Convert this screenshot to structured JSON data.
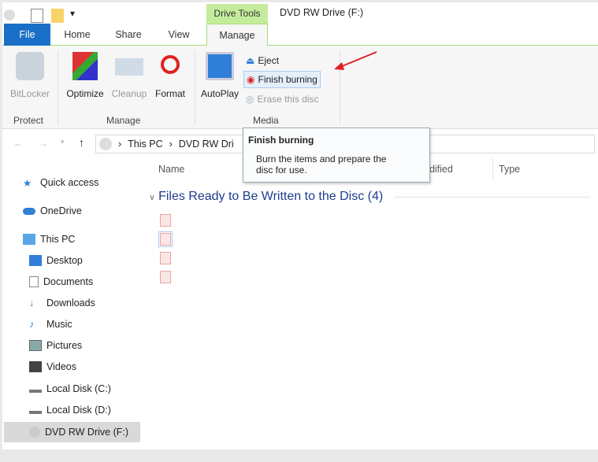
{
  "titlebar": {
    "context_tab": "Drive Tools",
    "title": "DVD RW Drive (F:)"
  },
  "tabs": [
    "File",
    "Home",
    "Share",
    "View",
    "Manage"
  ],
  "ribbon": {
    "protect": {
      "label": "Protect",
      "bitlocker": "BitLocker"
    },
    "manage": {
      "label": "Manage",
      "optimize": "Optimize",
      "cleanup": "Cleanup",
      "format": "Format"
    },
    "media": {
      "label": "Media",
      "autoplay": "AutoPlay",
      "eject": "Eject",
      "finish": "Finish burning",
      "erase": "Erase this disc"
    }
  },
  "address": {
    "crumbs": [
      "This PC",
      "DVD RW Dri"
    ]
  },
  "tooltip": {
    "title": "Finish burning",
    "body_line1": "Burn the items and prepare the",
    "body_line2": "disc for use."
  },
  "nav": [
    "Quick access",
    "OneDrive",
    "This PC",
    "Desktop",
    "Documents",
    "Downloads",
    "Music",
    "Pictures",
    "Videos",
    "Local Disk (C:)",
    "Local Disk (D:)",
    "DVD RW Drive (F:)"
  ],
  "columns": {
    "name": "Name",
    "date": "odified",
    "type": "Type"
  },
  "group_header": "Files Ready to Be Written to the Disc (4)",
  "colors": {
    "accent": "#1a6fc6",
    "context": "#c5ec9c",
    "arrow": "#e02020"
  }
}
